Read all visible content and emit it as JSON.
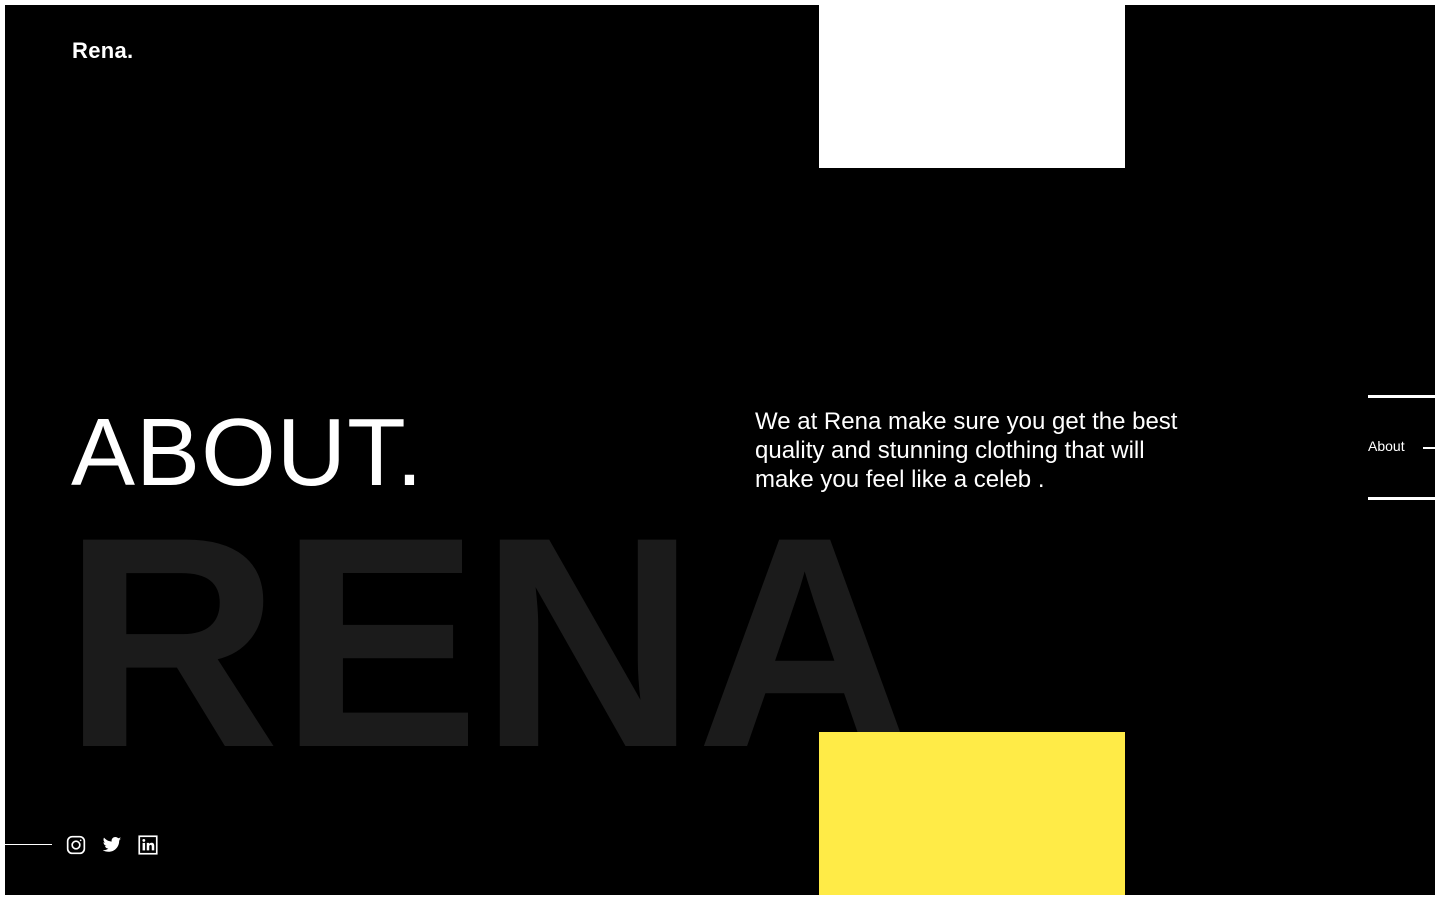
{
  "brand": {
    "logo": "Rena."
  },
  "hero": {
    "heading": "ABOUT.",
    "watermark": "RENA",
    "description": "We at Rena make sure you get the best quality and stunning clothing that will make you feel like a celeb ."
  },
  "side_nav": {
    "active_label": "About"
  },
  "social": {
    "icons": [
      "instagram-icon",
      "twitter-icon",
      "linkedin-icon"
    ]
  },
  "colors": {
    "background": "#000000",
    "accent_yellow": "#ffeb47",
    "block_white": "#ffffff",
    "watermark": "#1b1b1b"
  }
}
